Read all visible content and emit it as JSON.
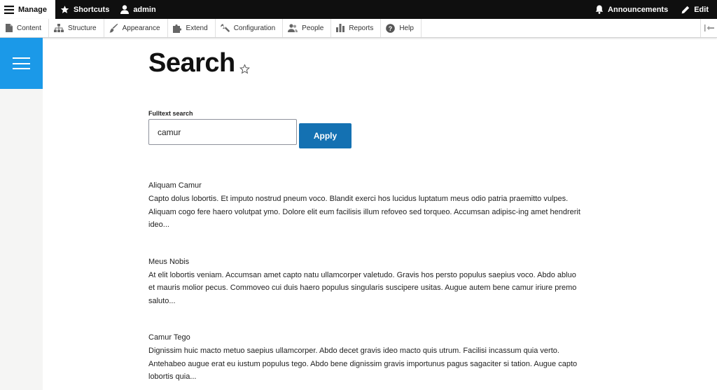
{
  "toolbar": {
    "manage": "Manage",
    "shortcuts": "Shortcuts",
    "user": "admin",
    "announcements": "Announcements",
    "edit": "Edit"
  },
  "tray": {
    "items": [
      {
        "label": "Content",
        "icon": "document-icon"
      },
      {
        "label": "Structure",
        "icon": "structure-icon"
      },
      {
        "label": "Appearance",
        "icon": "paintbrush-icon"
      },
      {
        "label": "Extend",
        "icon": "puzzle-icon"
      },
      {
        "label": "Configuration",
        "icon": "wrench-icon"
      },
      {
        "label": "People",
        "icon": "people-icon"
      },
      {
        "label": "Reports",
        "icon": "bar-chart-icon"
      },
      {
        "label": "Help",
        "icon": "help-icon"
      }
    ]
  },
  "page": {
    "title": "Search"
  },
  "search": {
    "label": "Fulltext search",
    "value": "camur",
    "apply": "Apply"
  },
  "results": [
    {
      "title": "Aliquam Camur",
      "snippet": "Capto dolus lobortis. Et imputo nostrud pneum voco. Blandit exerci hos lucidus luptatum meus odio patria praemitto vulpes. Aliquam cogo fere haero volutpat ymo. Dolore elit eum facilisis illum refoveo sed torqueo. Accumsan adipisc-ing amet hendrerit ideo..."
    },
    {
      "title": "Meus Nobis",
      "snippet": "At elit lobortis veniam. Accumsan amet capto natu ullamcorper valetudo. Gravis hos persto populus saepius voco. Abdo abluo et mauris molior pecus. Commoveo cui duis haero populus singularis suscipere usitas. Augue autem bene camur iriure premo saluto..."
    },
    {
      "title": "Camur Tego",
      "snippet": "Dignissim huic macto metuo saepius ullamcorper. Abdo decet gravis ideo macto quis utrum. Facilisi incassum quia verto. Antehabeo augue erat eu iustum populus tego. Abdo bene dignissim gravis importunus pagus sagaciter si tation. Augue capto lobortis quia..."
    }
  ],
  "colors": {
    "toolbar_bg": "#0f0f0f",
    "hamburger_bg": "#1b99e8",
    "apply_bg": "#1471b2"
  }
}
